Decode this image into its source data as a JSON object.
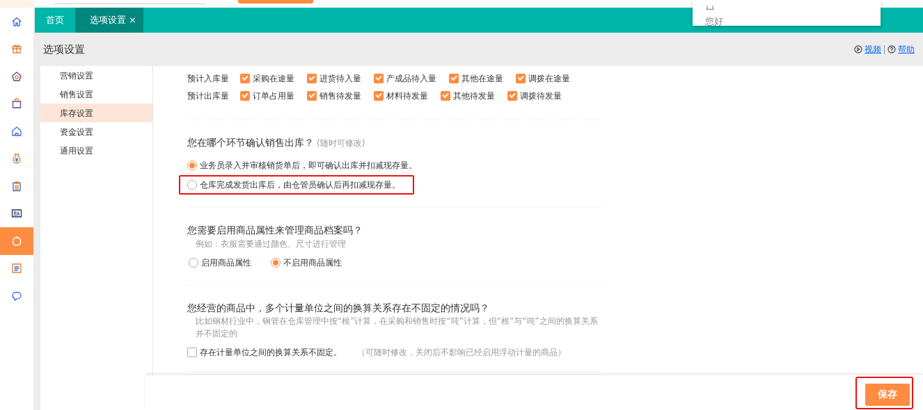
{
  "popup": {
    "text": "您好"
  },
  "rail": [
    {
      "selected": false
    },
    {
      "selected": false
    },
    {
      "selected": false
    },
    {
      "selected": false
    },
    {
      "selected": false
    },
    {
      "selected": false
    },
    {
      "selected": false
    },
    {
      "selected": false
    },
    {
      "selected": true
    },
    {
      "selected": false
    },
    {
      "selected": false
    }
  ],
  "tabs": [
    {
      "label": "首页",
      "selected": false
    },
    {
      "label": "选项设置",
      "selected": true,
      "close": "×"
    }
  ],
  "page_header": {
    "title": "选项设置",
    "links": [
      {
        "label": "视频"
      },
      {
        "label": "帮助"
      }
    ]
  },
  "subnav": [
    {
      "label": "营销设置",
      "selected": false
    },
    {
      "label": "销售设置",
      "selected": false
    },
    {
      "label": "库存设置",
      "selected": true
    },
    {
      "label": "资金设置",
      "selected": false
    },
    {
      "label": "通用设置",
      "selected": false
    }
  ],
  "sections": [
    {
      "kind": "checkgrid",
      "rows": [
        {
          "label": "预计入库量",
          "options": [
            {
              "label": "采购在途量",
              "checked": true
            },
            {
              "label": "进货待入量",
              "checked": true
            },
            {
              "label": "产成品待入量",
              "checked": true
            },
            {
              "label": "其他在途量",
              "checked": true
            },
            {
              "label": "调拨在途量",
              "checked": true
            }
          ]
        },
        {
          "label": "预计出库量",
          "options": [
            {
              "label": "订单占用量",
              "checked": true
            },
            {
              "label": "销售待发量",
              "checked": true
            },
            {
              "label": "材料待发量",
              "checked": true
            },
            {
              "label": "其他待发量",
              "checked": true
            },
            {
              "label": "调拨待发量",
              "checked": true
            }
          ]
        }
      ]
    },
    {
      "kind": "radio-list",
      "title": "您在哪个环节确认销售出库？",
      "note": "(随时可修改)",
      "options": [
        {
          "label": "业务员录入并审核销货单后，即可确认出库并扣减现存量。",
          "selected": true
        },
        {
          "label": "仓库完成发货出库后，由仓管员确认后再扣减现存量。",
          "selected": false,
          "highlighted": true
        }
      ]
    },
    {
      "kind": "radio-row",
      "title": "您需要启用商品属性来管理商品档案吗？",
      "hint": "例如：衣服需要通过颜色、尺寸进行管理",
      "options": [
        {
          "label": "启用商品属性",
          "selected": false
        },
        {
          "label": "不启用商品属性",
          "selected": true
        }
      ]
    },
    {
      "kind": "checkbox",
      "title": "您经营的商品中，多个计量单位之间的换算关系存在不固定的情况吗？",
      "hint": "比如钢材行业中，钢管在仓库管理中按“根”计算，在采购和销售时按“吨”计算，但“根”与“吨”之间的换算关系并不固定的",
      "option": {
        "label": "存在计量单位之间的换算关系不固定。",
        "checked": false
      },
      "note": "（可随时修改，关闭后不影响已经启用浮动计量的商品）"
    }
  ],
  "save_button": {
    "label": "保存",
    "highlighted": true
  }
}
